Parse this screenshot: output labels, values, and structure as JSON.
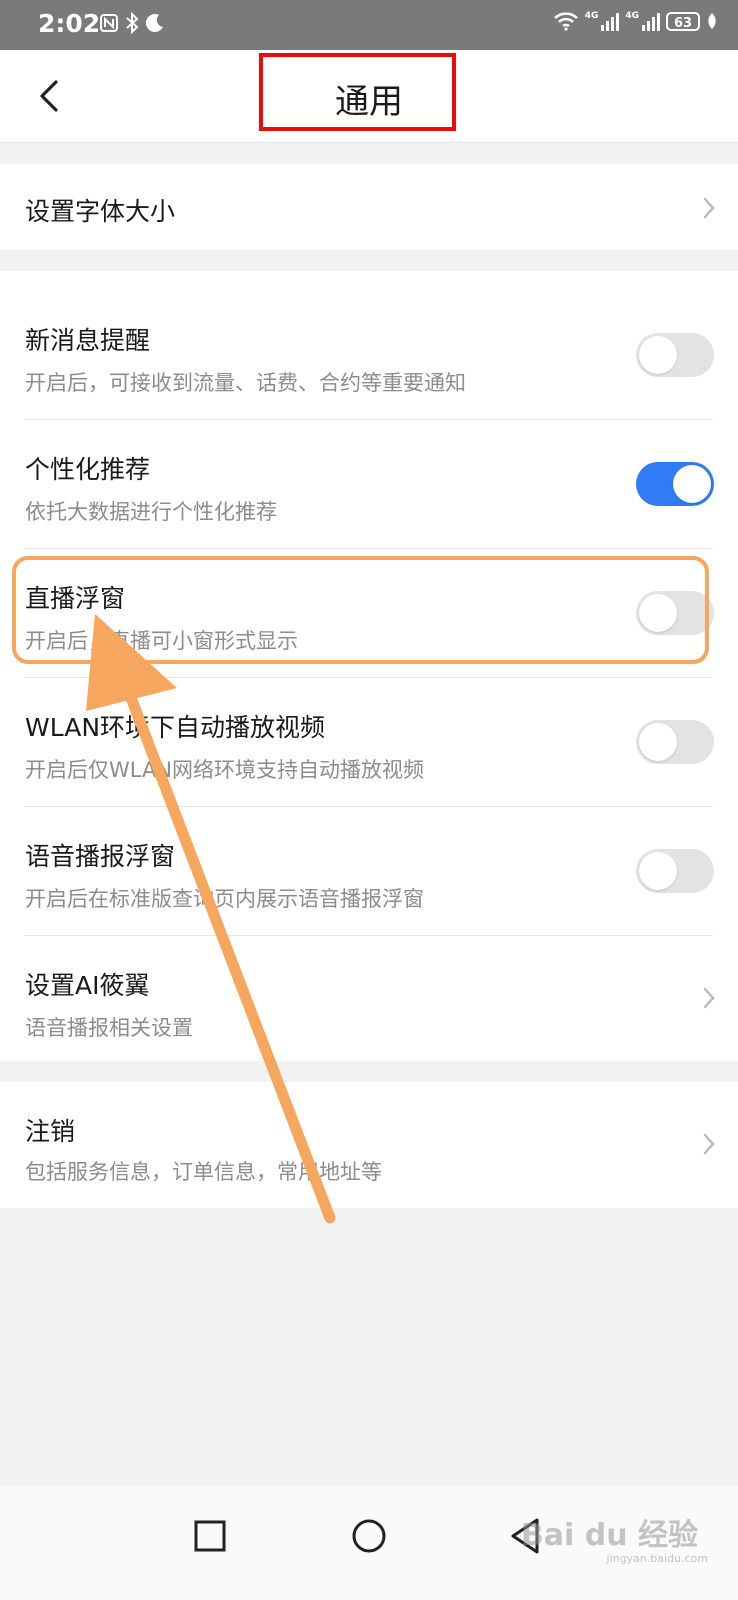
{
  "status_bar": {
    "time": "2:02",
    "network_label_1": "4G",
    "network_label_2": "4G",
    "battery": "63"
  },
  "header": {
    "title": "通用",
    "back_icon": "chevron-left-icon"
  },
  "settings": {
    "font_size": {
      "title": "设置字体大小"
    },
    "new_message": {
      "title": "新消息提醒",
      "subtitle": "开启后，可接收到流量、话费、合约等重要通知",
      "enabled": false
    },
    "personalized": {
      "title": "个性化推荐",
      "subtitle": "依托大数据进行个性化推荐",
      "enabled": true
    },
    "live_float": {
      "title": "直播浮窗",
      "subtitle": "开启后，直播可小窗形式显示",
      "enabled": false
    },
    "wlan_autoplay": {
      "title": "WLAN环境下自动播放视频",
      "subtitle": "开启后仅WLAN网络环境支持自动播放视频",
      "enabled": false
    },
    "voice_float": {
      "title": "语音播报浮窗",
      "subtitle": "开启后在标准版查询页内展示语音播报浮窗",
      "enabled": false
    },
    "ai_assistant": {
      "title": "设置AI筱翼",
      "subtitle": "语音播报相关设置"
    },
    "cancel_account": {
      "title": "注销",
      "subtitle": "包括服务信息，订单信息，常用地址等"
    }
  },
  "annotations": {
    "title_box_color": "#ee0b0b",
    "highlight_box_color": "#f6a75d",
    "arrow_color": "#f6a75d"
  },
  "watermark": {
    "brand": "Bai du 经验",
    "url": "jingyan.baidu.com"
  },
  "colors": {
    "toggle_on": "#2f7cf6",
    "toggle_off": "#e3e3e3"
  }
}
